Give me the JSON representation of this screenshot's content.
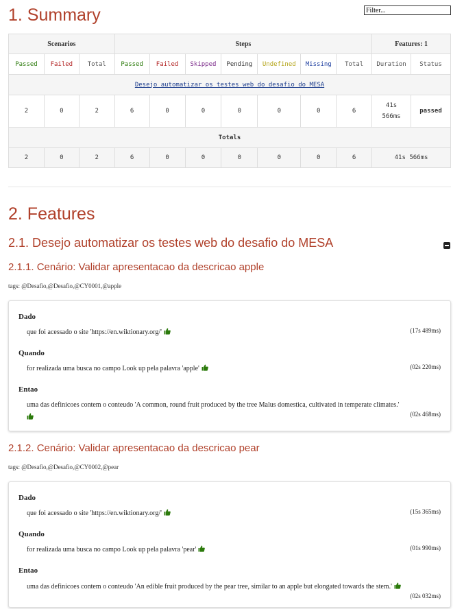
{
  "filter": {
    "placeholder": "Filter..."
  },
  "summary": {
    "title": "1. Summary",
    "groups": {
      "scenarios": "Scenarios",
      "steps": "Steps",
      "features": "Features: 1"
    },
    "headers": {
      "sc_passed": "Passed",
      "sc_failed": "Failed",
      "sc_total": "Total",
      "st_passed": "Passed",
      "st_failed": "Failed",
      "st_skipped": "Skipped",
      "st_pending": "Pending",
      "st_undefined": "Undefined",
      "st_missing": "Missing",
      "st_total": "Total",
      "duration": "Duration",
      "status": "Status"
    },
    "feature_link": "Desejo automatizar os testes web do desafio do MESA",
    "row": {
      "sc_passed": "2",
      "sc_failed": "0",
      "sc_total": "2",
      "st_passed": "6",
      "st_failed": "0",
      "st_skipped": "0",
      "st_pending": "0",
      "st_undefined": "0",
      "st_missing": "0",
      "st_total": "6",
      "duration_l1": "41s",
      "duration_l2": "566ms",
      "status": "passed"
    },
    "totals_label": "Totals",
    "totals": {
      "sc_passed": "2",
      "sc_failed": "0",
      "sc_total": "2",
      "st_passed": "6",
      "st_failed": "0",
      "st_skipped": "0",
      "st_pending": "0",
      "st_undefined": "0",
      "st_missing": "0",
      "st_total": "6",
      "duration": "41s 566ms"
    }
  },
  "features": {
    "title": "2. Features",
    "feature_title": "2.1. Desejo automatizar os testes web do desafio do MESA",
    "scenarios": [
      {
        "title": "2.1.1. Cenário: Validar apresentacao da descricao apple",
        "tags": "tags: @Desafio,@Desafio,@CY0001,@apple",
        "steps": [
          {
            "keyword": "Dado",
            "text": "que foi acessado o site 'https://en.wiktionary.org/'",
            "duration": "(17s 489ms)"
          },
          {
            "keyword": "Quando",
            "text": "for realizada uma busca no campo Look up pela palavra 'apple'",
            "duration": "(02s 220ms)"
          },
          {
            "keyword": "Entao",
            "text": "uma das definicoes contem o conteudo 'A common, round fruit produced by the tree Malus domestica, cultivated in temperate climates.'",
            "duration": "(02s 468ms)"
          }
        ]
      },
      {
        "title": "2.1.2. Cenário: Validar apresentacao da descricao pear",
        "tags": "tags: @Desafio,@Desafio,@CY0002,@pear",
        "steps": [
          {
            "keyword": "Dado",
            "text": "que foi acessado o site 'https://en.wiktionary.org/'",
            "duration": "(15s 365ms)"
          },
          {
            "keyword": "Quando",
            "text": "for realizada uma busca no campo Look up pela palavra 'pear'",
            "duration": "(01s 990ms)"
          },
          {
            "keyword": "Entao",
            "text": "uma das definicoes contem o conteudo 'An edible fruit produced by the pear tree, similar to an apple but elongated towards the stem.'",
            "duration": "(02s 032ms)"
          }
        ]
      }
    ]
  },
  "colors": {
    "heading": "#b0402a",
    "passed": "#2b7a0b",
    "failed": "#b22222",
    "skipped": "#7b2a8a",
    "undefined": "#b5a51a",
    "missing": "#1e3fa0",
    "link": "#1a3b8c"
  },
  "icons": {
    "step_passed": "thumbs-up-icon",
    "collapse": "collapse-icon"
  }
}
